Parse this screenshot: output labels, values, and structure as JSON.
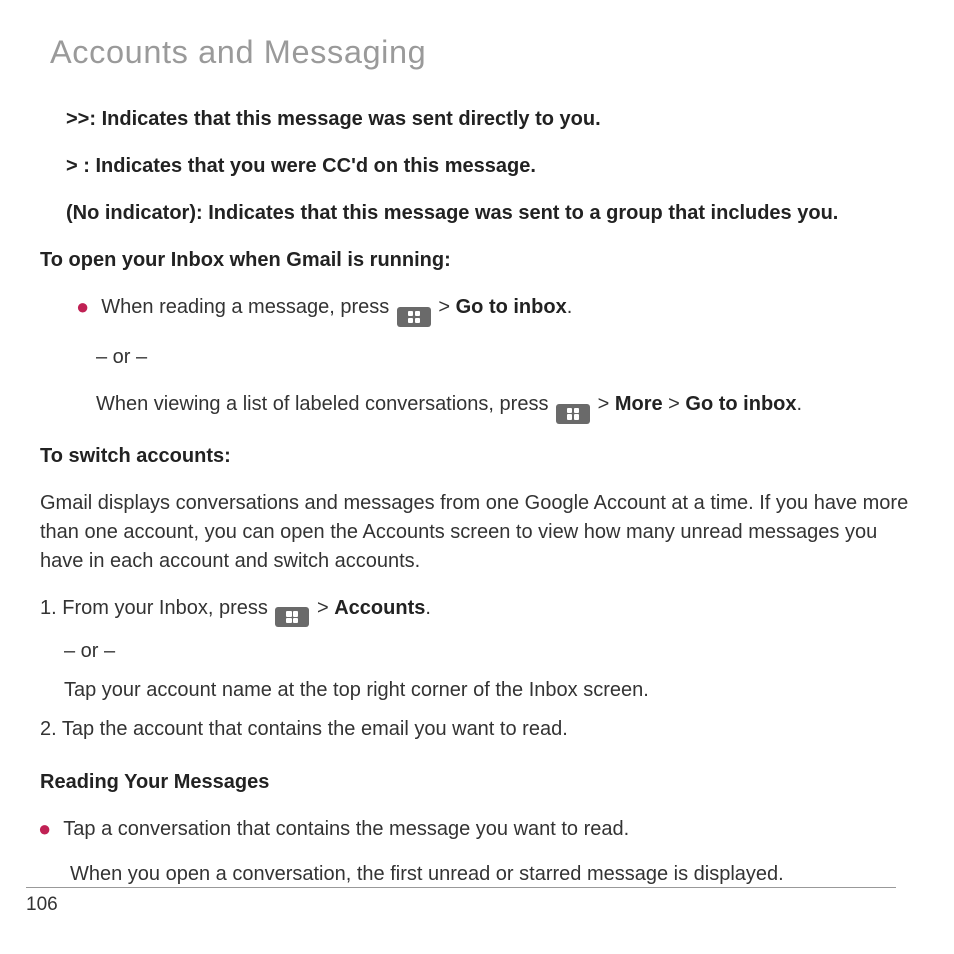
{
  "header": {
    "title": "Accounts and Messaging"
  },
  "indicators": {
    "direct": ">>: Indicates that this message was sent directly to you.",
    "cc": ">  : Indicates that you were CC'd on this message.",
    "none": "(No indicator): Indicates that this message was sent to a group that includes you."
  },
  "inbox": {
    "heading": "To open your Inbox when Gmail is running:",
    "bullet_pre": "When reading a message, press ",
    "path1_sep": " > ",
    "path1_dest": "Go to inbox",
    "or": "– or –",
    "alt_pre": "When viewing a list of labeled conversations, press ",
    "alt_sep1": " > ",
    "alt_more": "More",
    "alt_sep2": " > ",
    "alt_dest": "Go to inbox",
    "period": "."
  },
  "switch": {
    "heading": "To switch accounts:",
    "para": "Gmail displays conversations and messages from one Google Account at a time. If you have more than one account, you can open the Accounts screen to view how many unread messages you have in each account and switch accounts.",
    "step1_pre": "1. From your Inbox, press ",
    "step1_sep": " > ",
    "step1_dest": "Accounts",
    "or": "– or –",
    "step1_alt": "Tap your account name at the top right corner of the Inbox screen.",
    "step2": "2. Tap the account that contains the email you want to read.",
    "period": "."
  },
  "reading": {
    "heading": "Reading Your Messages",
    "bullet": "Tap a conversation that contains the message you want to read.",
    "followup": "When you open a conversation, the first unread or starred message is displayed."
  },
  "footer": {
    "page_number": "106"
  }
}
